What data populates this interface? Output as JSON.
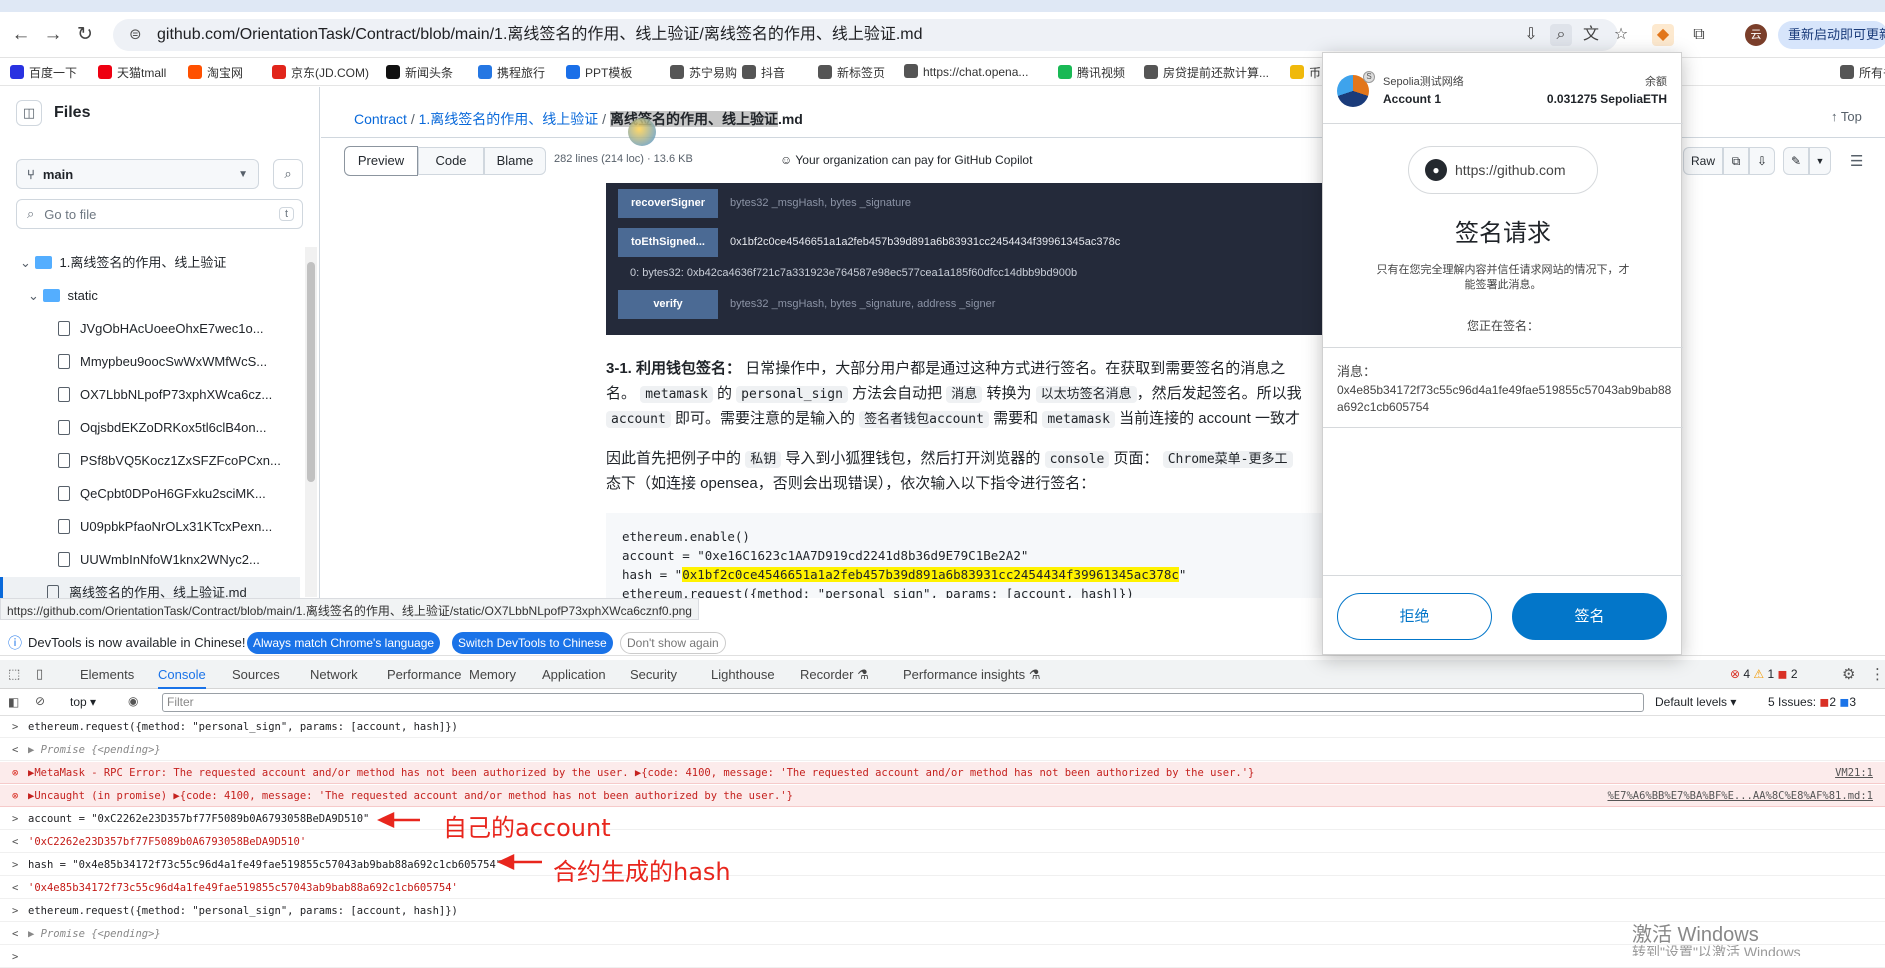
{
  "browser": {
    "url": "github.com/OrientationTask/Contract/blob/main/1.离线签名的作用、线上验证/离线签名的作用、线上验证.md",
    "relaunch_label": "重新启动即可更新",
    "avatar_letter": "云"
  },
  "bookmarks": [
    {
      "label": "百度一下",
      "color": "#2932e1"
    },
    {
      "label": "天猫tmall",
      "color": "#e01"
    },
    {
      "label": "淘宝网",
      "color": "#ff5000"
    },
    {
      "label": "京东(JD.COM)",
      "color": "#e1251b"
    },
    {
      "label": "新闻头条",
      "color": "#111"
    },
    {
      "label": "携程旅行",
      "color": "#2577e3"
    },
    {
      "label": "PPT模板",
      "color": "#1a6fe8"
    },
    {
      "label": "苏宁易购",
      "color": "#555"
    },
    {
      "label": "抖音",
      "color": "#555"
    },
    {
      "label": "新标签页",
      "color": "#555"
    },
    {
      "label": "https://chat.opena...",
      "color": "#555"
    },
    {
      "label": "腾讯视频",
      "color": "#19b955"
    },
    {
      "label": "房贷提前还款计算...",
      "color": "#555"
    },
    {
      "label": "币",
      "color": "#f0b90b"
    },
    {
      "label": "所有书",
      "color": "#555"
    }
  ],
  "sidebar": {
    "title": "Files",
    "branch": "main",
    "goto_placeholder": "Go to file",
    "goto_shortcut": "t",
    "tree": [
      {
        "label": "1.离线签名的作用、线上验证",
        "type": "folder",
        "level": 1
      },
      {
        "label": "static",
        "type": "folder",
        "level": 2
      },
      {
        "label": "JVgObHAcUoeeOhxE7wec1o...",
        "type": "file",
        "level": 3
      },
      {
        "label": "Mmypbeu9oocSwWxWMfWcS...",
        "type": "file",
        "level": 3
      },
      {
        "label": "OX7LbbNLpofP73xphXWca6cz...",
        "type": "file",
        "level": 3
      },
      {
        "label": "OqjsbdEKZoDRKox5tl6clB4on...",
        "type": "file",
        "level": 3
      },
      {
        "label": "PSf8bVQ5Kocz1ZxSFZFcoPCxn...",
        "type": "file",
        "level": 3
      },
      {
        "label": "QeCpbt0DPoH6GFxku2sciMK...",
        "type": "file",
        "level": 3
      },
      {
        "label": "U09pbkPfaoNrOLx31KTcxPexn...",
        "type": "file",
        "level": 3
      },
      {
        "label": "UUWmbInNfoW1knx2WNyc2...",
        "type": "file",
        "level": 3
      },
      {
        "label": "离线签名的作用、线上验证.md",
        "type": "file",
        "level": 2,
        "selected": true
      }
    ]
  },
  "main": {
    "breadcrumb_root": "Contract",
    "breadcrumb_folder": "1.离线签名的作用、线上验证",
    "breadcrumb_file": "离线签名的作用、线上验证",
    "breadcrumb_ext": ".md",
    "top_label": "Top",
    "tabs": [
      "Preview",
      "Code",
      "Blame"
    ],
    "file_meta": "282 lines (214 loc) · 13.6 KB",
    "copilot_note": "Your organization can pay for GitHub Copilot",
    "raw_label": "Raw",
    "functions": [
      {
        "name": "recoverSigner",
        "arg": "bytes32 _msgHash, bytes _signature"
      },
      {
        "name": "toEthSigned...",
        "arg": "0x1bf2c0ce4546651a1a2feb457b39d891a6b83931cc2454434f39961345ac378c"
      },
      {
        "name": "verify",
        "arg": "bytes32 _msgHash, bytes _signature, address _signer"
      }
    ],
    "result_line": "0: bytes32: 0xb42ca4636f721c7a331923e764587e98ec577cea1a185f60dfcc14dbb9bd900b",
    "para1_heading": "3-1. 利用钱包签名：",
    "para1_a": "日常操作中，大部分用户都是通过这种方式进行签名。在获取到需要签名的消息之",
    "para1_b1": "名。",
    "para1_code1": "metamask",
    "para1_b2": "的",
    "para1_code2": "personal_sign",
    "para1_b3": "方法会自动把",
    "para1_code3": "消息",
    "para1_b4": "转换为",
    "para1_code4": "以太坊签名消息",
    "para1_b5": "，然后发起签名。所以我",
    "para1_code5": "account",
    "para1_c1": "即可。需要注意的是输入的",
    "para1_code6": "签名者钱包account",
    "para1_c2": "需要和",
    "para1_code7": "metamask",
    "para1_c3": "当前连接的 account 一致才",
    "para2_a1": "因此首先把例子中的",
    "para2_code1": "私钥",
    "para2_a2": "导入到小狐狸钱包，然后打开浏览器的",
    "para2_code2": "console",
    "para2_a3": "页面：",
    "para2_code3": "Chrome菜单-更多工",
    "para2_b": "态下（如连接 opensea，否则会出现错误），依次输入以下指令进行签名：",
    "code_lines": [
      "ethereum.enable()",
      "account = \"0xe16C1623c1AA7D919cd2241d8b36d9E79C1Be2A2\"",
      "hash = \"",
      "ethereum.request({method: \"personal_sign\", params: [account, hash]})"
    ],
    "code_hash_highlight": "0x1bf2c0ce4546651a1a2feb457b39d891a6b83931cc2454434f39961345ac378c",
    "code_hash_tail": "\""
  },
  "status_url": "https://github.com/OrientationTask/Contract/blob/main/1.离线签名的作用、线上验证/static/OX7LbbNLpofP73xphXWca6cznf0.png",
  "devtools": {
    "info_text": "DevTools is now available in Chinese!",
    "btn_match": "Always match Chrome's language",
    "btn_switch": "Switch DevTools to Chinese",
    "btn_dont": "Don't show again",
    "tabs": [
      "Elements",
      "Console",
      "Sources",
      "Network",
      "Performance",
      "Memory",
      "Application",
      "Security",
      "Lighthouse",
      "Recorder ⚗",
      "Performance insights ⚗"
    ],
    "active_tab": "Console",
    "err_count": "4",
    "warn_count": "1",
    "info_count": "2",
    "context": "top",
    "filter_placeholder": "Filter",
    "levels": "Default levels ▾",
    "issues_label": "5 Issues:",
    "issues_err": "2",
    "issues_info": "3",
    "log": [
      {
        "kind": "input",
        "prefix": ">",
        "text": "ethereum.request({method: \"personal_sign\", params: [account, hash]})"
      },
      {
        "kind": "output",
        "prefix": "<",
        "text": "▶ Promise  {<pending>}"
      },
      {
        "kind": "error",
        "prefix": "⊗",
        "text": "▶MetaMask - RPC Error: The requested account and/or method has not been authorized by the user.  ▶{code: 4100, message: 'The requested account and/or method has not been authorized by the user.'}",
        "source": "VM21:1"
      },
      {
        "kind": "error",
        "prefix": "⊗",
        "text": "▶Uncaught (in promise) ▶{code: 4100, message: 'The requested account and/or method has not been authorized by the user.'}",
        "source": "%E7%A6%BB%E7%BA%BF%E...AA%8C%E8%AF%81.md:1"
      },
      {
        "kind": "input",
        "prefix": ">",
        "text": "account = \"0xC2262e23D357bf77F5089b0A6793058BeDA9D510\""
      },
      {
        "kind": "output",
        "prefix": "<",
        "text": "'0xC2262e23D357bf77F5089b0A6793058BeDA9D510'"
      },
      {
        "kind": "input",
        "prefix": ">",
        "text": "hash = \"0x4e85b34172f73c55c96d4a1fe49fae519855c57043ab9bab88a692c1cb605754\""
      },
      {
        "kind": "output",
        "prefix": "<",
        "text": "'0x4e85b34172f73c55c96d4a1fe49fae519855c57043ab9bab88a692c1cb605754'"
      },
      {
        "kind": "input",
        "prefix": ">",
        "text": "ethereum.request({method: \"personal_sign\", params: [account, hash]})"
      },
      {
        "kind": "output",
        "prefix": "<",
        "text": "▶ Promise  {<pending>}"
      },
      {
        "kind": "input",
        "prefix": ">",
        "text": ""
      }
    ],
    "annotation_account": "自己的account",
    "annotation_hash": "合约生成的hash"
  },
  "metamask": {
    "network": "Sepolia测试网络",
    "account": "Account 1",
    "balance_label": "余额",
    "balance": "0.031275 SepoliaETH",
    "origin": "https://github.com",
    "title": "签名请求",
    "warning": "只有在您完全理解内容并信任请求网站的情况下，才能签署此消息。",
    "signing_label": "您正在签名：",
    "message_label": "消息：",
    "message": "0x4e85b34172f73c55c96d4a1fe49fae519855c57043ab9bab88a692c1cb605754",
    "reject": "拒绝",
    "sign": "签名"
  },
  "watermark": {
    "line1": "激活 Windows",
    "line2": "转到\"设置\"以激活 Windows"
  },
  "colors": {
    "accent": "#0376c9",
    "github_blue": "#0969da",
    "error_red": "#d93025"
  }
}
